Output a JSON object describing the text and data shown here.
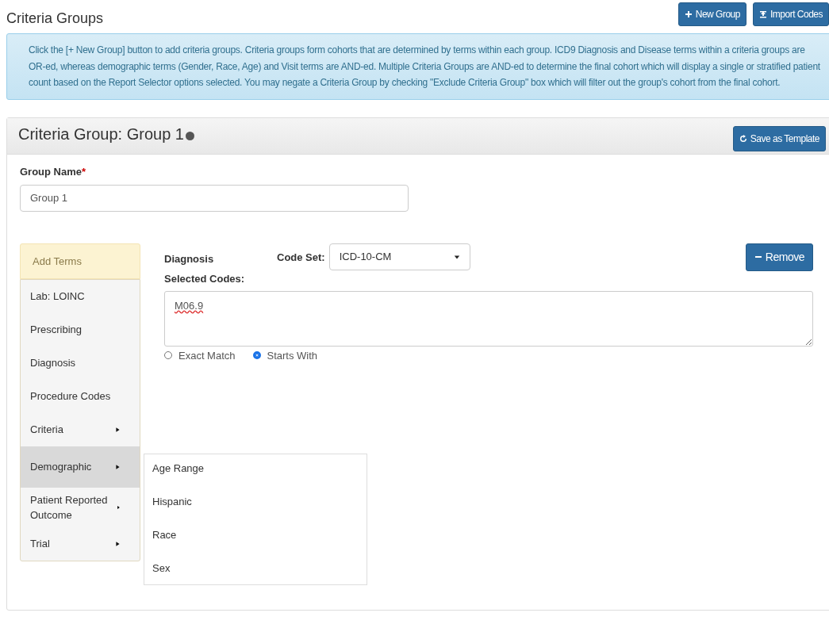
{
  "page": {
    "title": "Criteria Groups"
  },
  "header_buttons": [
    {
      "label": "New Group"
    },
    {
      "label": "Import Codes"
    }
  ],
  "info": "Click the [+ New Group] button to add criteria groups. Criteria groups form cohorts that are determined by terms within each group. ICD9 Diagnosis and Disease terms within a criteria groups are OR-ed, whereas demographic terms (Gender, Race, Age) and Visit terms are AND-ed. Multiple Criteria Groups are AND-ed to determine the final cohort which will display a single or stratified patient count based on the Report Selector options selected. You may negate a Criteria Group by checking \"Exclude Criteria Group\" box which will filter out the group's cohort from the final cohort.",
  "panel": {
    "title": "Criteria Group: Group 1",
    "save_button": "Save as Template",
    "group_name": {
      "label": "Group Name",
      "required_mark": "*",
      "value": "Group 1"
    },
    "add_terms": {
      "label": "Add Terms",
      "items": [
        {
          "label": "Lab: LOINC",
          "submenu": false,
          "selected": false
        },
        {
          "label": "Prescribing",
          "submenu": false,
          "selected": false
        },
        {
          "label": "Diagnosis",
          "submenu": false,
          "selected": false
        },
        {
          "label": "Procedure Codes",
          "submenu": false,
          "selected": false
        },
        {
          "label": "Criteria",
          "submenu": true,
          "selected": false
        },
        {
          "label": "Demographic",
          "submenu": true,
          "selected": true,
          "children": [
            {
              "label": "Age Range"
            },
            {
              "label": "Hispanic"
            },
            {
              "label": "Race"
            },
            {
              "label": "Sex"
            }
          ]
        },
        {
          "label": "Patient Reported Outcome",
          "submenu": true,
          "selected": false
        },
        {
          "label": "Trial",
          "submenu": true,
          "selected": false
        }
      ]
    },
    "term": {
      "title": "Diagnosis",
      "code_set_label": "Code Set:",
      "code_set": "ICD-10-CM",
      "remove_button": "Remove",
      "selected_codes_label": "Selected Codes:",
      "selected_codes": "M06.9",
      "match": [
        {
          "label": "Exact Match",
          "selected": false
        },
        {
          "label": "Starts With",
          "selected": true
        }
      ]
    }
  }
}
